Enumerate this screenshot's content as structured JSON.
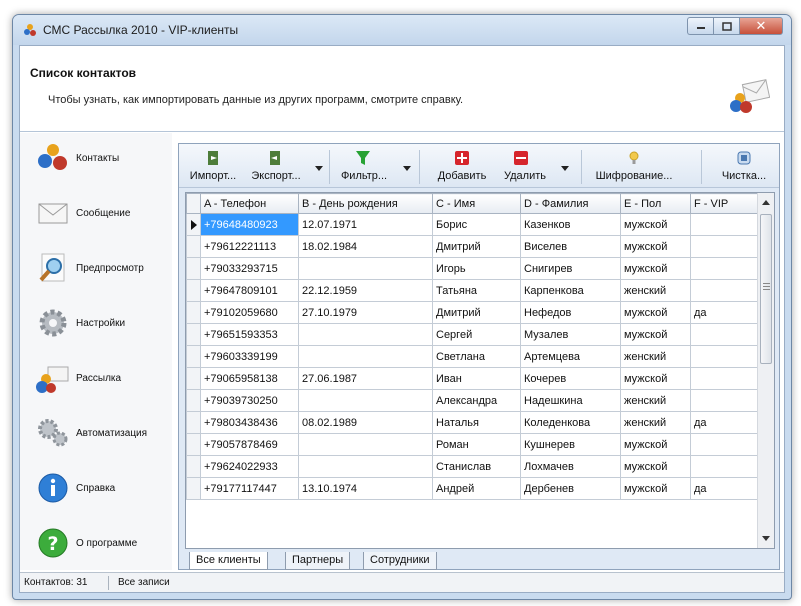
{
  "window": {
    "title": "СМС Рассылка 2010 - VIP-клиенты"
  },
  "header": {
    "title": "Список контактов",
    "description": "Чтобы узнать, как импортировать данные из других программ, смотрите справку."
  },
  "sidebar": {
    "items": [
      {
        "label": "Контакты",
        "icon": "people-icon"
      },
      {
        "label": "Сообщение",
        "icon": "envelope-icon"
      },
      {
        "label": "Предпросмотр",
        "icon": "magnifier-icon"
      },
      {
        "label": "Настройки",
        "icon": "gear-icon"
      },
      {
        "label": "Рассылка",
        "icon": "people-mail-icon"
      },
      {
        "label": "Автоматизация",
        "icon": "gears-icon"
      },
      {
        "label": "Справка",
        "icon": "info-icon"
      },
      {
        "label": "О программе",
        "icon": "help-icon"
      }
    ]
  },
  "toolbar": {
    "import_label": "Импорт...",
    "export_label": "Экспорт...",
    "filter_label": "Фильтр...",
    "add_label": "Добавить",
    "delete_label": "Удалить",
    "encrypt_label": "Шифрование...",
    "clean_label": "Чистка..."
  },
  "grid": {
    "columns": [
      "A - Телефон",
      "B - День рождения",
      "C - Имя",
      "D - Фамилия",
      "E - Пол",
      "F - VIP"
    ],
    "rows": [
      [
        "+79648480923",
        "12.07.1971",
        "Борис",
        "Казенков",
        "мужской",
        ""
      ],
      [
        "+79612221113",
        "18.02.1984",
        "Дмитрий",
        "Виселев",
        "мужской",
        ""
      ],
      [
        "+79033293715",
        "",
        "Игорь",
        "Снигирев",
        "мужской",
        ""
      ],
      [
        "+79647809101",
        "22.12.1959",
        "Татьяна",
        "Карпенкова",
        "женский",
        ""
      ],
      [
        "+79102059680",
        "27.10.1979",
        "Дмитрий",
        "Нефедов",
        "мужской",
        "да"
      ],
      [
        "+79651593353",
        "",
        "Сергей",
        "Музалев",
        "мужской",
        ""
      ],
      [
        "+79603339199",
        "",
        "Светлана",
        "Артемцева",
        "женский",
        ""
      ],
      [
        "+79065958138",
        "27.06.1987",
        "Иван",
        "Кочерев",
        "мужской",
        ""
      ],
      [
        "+79039730250",
        "",
        "Александра",
        "Надешкина",
        "женский",
        ""
      ],
      [
        "+79803438436",
        "08.02.1989",
        "Наталья",
        "Коледенкова",
        "женский",
        "да"
      ],
      [
        "+79057878469",
        "",
        "Роман",
        "Кушнерев",
        "мужской",
        ""
      ],
      [
        "+79624022933",
        "",
        "Станислав",
        "Лохмачев",
        "мужской",
        ""
      ],
      [
        "+79177117447",
        "13.10.1974",
        "Андрей",
        "Дербенев",
        "мужской",
        "да"
      ]
    ]
  },
  "sheet_tabs": [
    "Все клиенты",
    "Партнеры",
    "Сотрудники"
  ],
  "status": {
    "count": "Контактов: 31",
    "filter": "Все записи"
  },
  "colors": {
    "selection": "#3399ff",
    "title_bar": "#c3d6ec",
    "close_button": "#c7503a"
  }
}
